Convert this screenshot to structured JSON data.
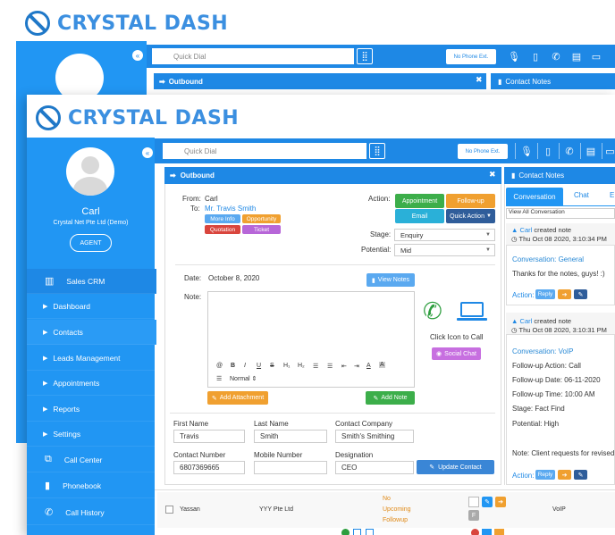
{
  "brand": {
    "name": "CRYSTAL DASH"
  },
  "back": {
    "quick_dial": "Quick Dial",
    "no_phone": "No Phone Ext.",
    "outbound": "Outbound",
    "contact_notes": "Contact Notes"
  },
  "front": {
    "user": {
      "name": "Carl",
      "company": "Crystal Net Pte Ltd (Demo)",
      "role": "AGENT"
    },
    "menu": [
      {
        "label": "Sales CRM",
        "type": "header"
      },
      {
        "label": "Dashboard",
        "type": "sub"
      },
      {
        "label": "Contacts",
        "type": "sub"
      },
      {
        "label": "Leads Management",
        "type": "sub"
      },
      {
        "label": "Appointments",
        "type": "sub"
      },
      {
        "label": "Reports",
        "type": "sub"
      },
      {
        "label": "Settings",
        "type": "sub"
      },
      {
        "label": "Call Center",
        "type": "icon"
      },
      {
        "label": "Phonebook",
        "type": "icon"
      },
      {
        "label": "Call History",
        "type": "icon"
      }
    ],
    "topbar": {
      "quick_dial": "Quick Dial",
      "no_phone": "No Phone Ext."
    },
    "outbound": {
      "title": "Outbound",
      "from_label": "From:",
      "from_value": "Carl",
      "to_label": "To:",
      "to_value": "Mr. Travis Smith",
      "tags": {
        "more_info": "More Info",
        "opportunity": "Opportunity",
        "quotation": "Quotation",
        "ticket": "Ticket"
      },
      "action_label": "Action:",
      "actions": {
        "appointment": "Appointment",
        "follow_up": "Follow-up",
        "email": "Email",
        "quick_action": "Quick Action"
      },
      "stage_label": "Stage:",
      "stage_value": "Enquiry",
      "potential_label": "Potential:",
      "potential_value": "Mid",
      "date_label": "Date:",
      "date_value": "October 8, 2020",
      "view_notes": "View Notes",
      "note_label": "Note:",
      "call_hint": "Click Icon to Call",
      "social_chat": "Social Chat",
      "editor": {
        "format": "Normal"
      },
      "add_attachment": "Add Attachment",
      "add_note": "Add Note",
      "form": {
        "first_name_label": "First Name",
        "first_name": "Travis",
        "last_name_label": "Last Name",
        "last_name": "Smith",
        "company_label": "Contact Company",
        "company": "Smith's Smithing",
        "number_label": "Contact Number",
        "number": "6807369665",
        "mobile_label": "Mobile Number",
        "mobile": "",
        "designation_label": "Designation",
        "designation": "CEO",
        "update_button": "Update Contact"
      }
    },
    "notes": {
      "title": "Contact Notes",
      "tabs": [
        "Conversation",
        "Chat",
        "E"
      ],
      "view_all": "View All Conversation",
      "entries": [
        {
          "author": "Carl",
          "created": "created note",
          "date": "Thu Oct 08 2020, 3:10:34 PM",
          "topic": "Conversation: General",
          "lines": [
            "Thanks for the notes, guys! :)"
          ],
          "reply": "Reply",
          "action": "Action:"
        },
        {
          "author": "Carl",
          "created": "created note",
          "date": "Thu Oct 08 2020, 3:10:31 PM",
          "topic": "Conversation: VoIP",
          "lines": [
            "Follow-up Action: Call",
            "Follow-up Date: 06-11-2020",
            "Follow-up Time: 10:00 AM",
            "Stage: Fact Find",
            "Potential: High",
            "",
            "Note: Client requests for revised p"
          ],
          "reply": "Reply",
          "action": "Action:"
        }
      ]
    },
    "list_row": {
      "name": "Yassan",
      "company": "YYY Pte Ltd",
      "followup": "No Upcoming Followup",
      "badge": "F",
      "channel": "VoIP"
    }
  }
}
